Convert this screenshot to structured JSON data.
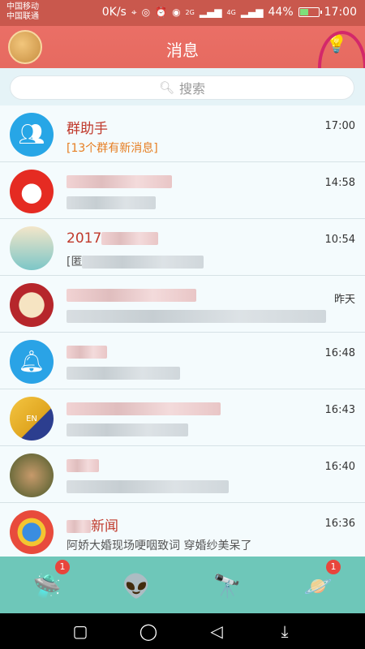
{
  "status": {
    "carrier1": "中国移动",
    "carrier2": "中国联通",
    "speed": "0K/s",
    "net1": "2G",
    "net2": "4G",
    "battery": "44%",
    "time": "17:00"
  },
  "header": {
    "title": "消息"
  },
  "search": {
    "placeholder": "搜索"
  },
  "chats": [
    {
      "name": "群助手",
      "preview": "[13个群有新消息]",
      "time": "17:00"
    },
    {
      "name": "",
      "preview": "",
      "time": "14:58"
    },
    {
      "name": "2017",
      "preview": "[匿",
      "time": "10:54"
    },
    {
      "name": "",
      "preview": "",
      "time": "昨天"
    },
    {
      "name": "",
      "preview": "",
      "time": "16:48"
    },
    {
      "name": "",
      "preview": "",
      "time": "16:43"
    },
    {
      "name": "",
      "preview": "",
      "time": "16:40"
    },
    {
      "name": "新闻",
      "preview": "阿娇大婚现场哽咽致词 穿婚纱美呆了",
      "time": "16:36"
    }
  ],
  "tabs": [
    {
      "badge": "1"
    },
    {
      "badge": ""
    },
    {
      "badge": ""
    },
    {
      "badge": "1"
    }
  ]
}
